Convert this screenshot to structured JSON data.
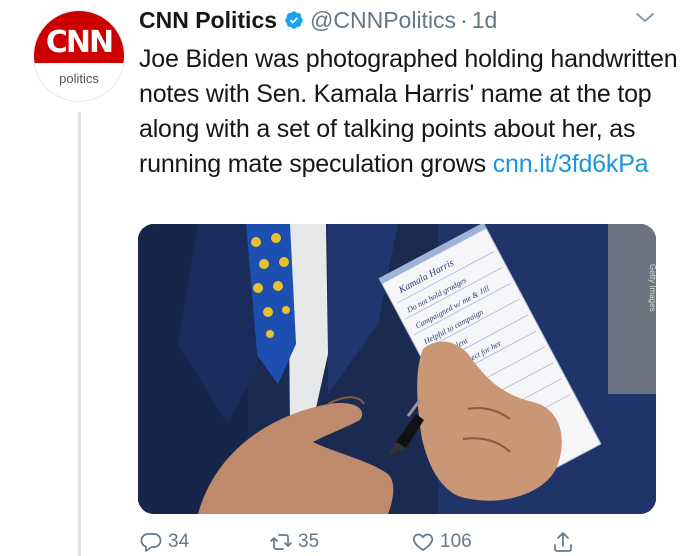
{
  "account": {
    "avatar_logo": "CNN",
    "avatar_subtitle": "politics",
    "display_name": "CNN Politics",
    "handle": "@CNNPolitics",
    "separator": "·",
    "time": "1d",
    "verified": true
  },
  "tweet": {
    "text": "Joe Biden was photographed holding handwritten notes with Sen. Kamala Harris' name at the top along with a set of talking points about her, as running mate speculation grows ",
    "link": "cnn.it/3fd6kPa"
  },
  "media": {
    "photo_credit": "Getty Images",
    "note_header": "Kamala Harris",
    "note_lines": [
      "Do not hold grudges",
      "Campaigned w/ me & Jill",
      "Helpful to campaign",
      "Great talent",
      "Great respect for her"
    ]
  },
  "actions": {
    "replies": "34",
    "retweets": "35",
    "likes": "106"
  },
  "colors": {
    "accent": "#1b95e0",
    "cnn_red": "#cc0000",
    "muted": "#657786"
  },
  "icons": [
    "verified-badge-icon",
    "chevron-down-icon",
    "reply-icon",
    "retweet-icon",
    "like-icon",
    "share-icon"
  ]
}
